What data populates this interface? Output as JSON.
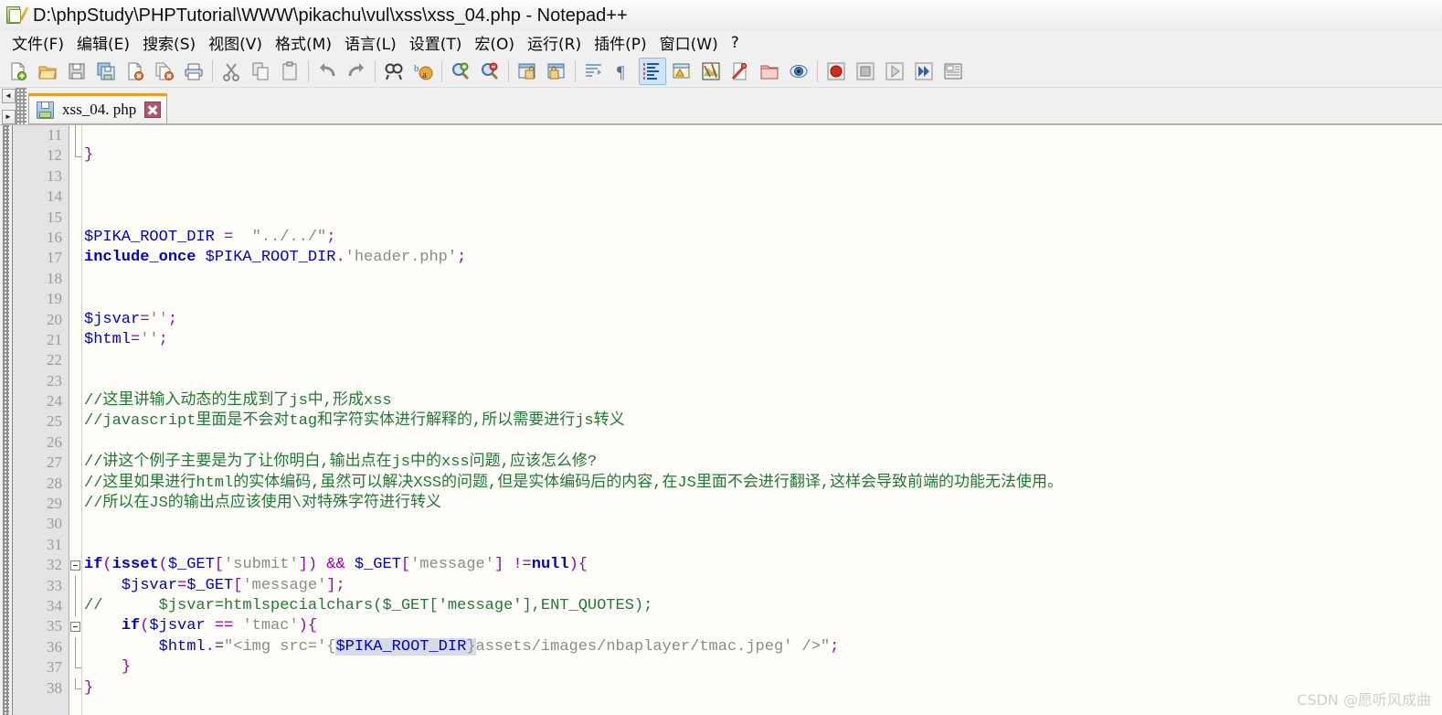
{
  "window": {
    "title": "D:\\phpStudy\\PHPTutorial\\WWW\\pikachu\\vul\\xss\\xss_04.php - Notepad++",
    "app_icon": "notepadpp-icon"
  },
  "menubar": {
    "items": [
      {
        "label": "文件(F)",
        "name": "menu-file"
      },
      {
        "label": "编辑(E)",
        "name": "menu-edit"
      },
      {
        "label": "搜索(S)",
        "name": "menu-search"
      },
      {
        "label": "视图(V)",
        "name": "menu-view"
      },
      {
        "label": "格式(M)",
        "name": "menu-format"
      },
      {
        "label": "语言(L)",
        "name": "menu-language"
      },
      {
        "label": "设置(T)",
        "name": "menu-settings"
      },
      {
        "label": "宏(O)",
        "name": "menu-macro"
      },
      {
        "label": "运行(R)",
        "name": "menu-run"
      },
      {
        "label": "插件(P)",
        "name": "menu-plugins"
      },
      {
        "label": "窗口(W)",
        "name": "menu-window"
      },
      {
        "label": "?",
        "name": "menu-help"
      }
    ]
  },
  "toolbar": {
    "groups": [
      [
        "new-file-icon",
        "open-folder-icon",
        "save-icon",
        "save-all-icon",
        "close-file-icon",
        "close-all-files-icon",
        "print-icon"
      ],
      [
        "cut-icon",
        "copy-icon",
        "paste-icon"
      ],
      [
        "undo-icon",
        "redo-icon"
      ],
      [
        "find-icon",
        "replace-icon"
      ],
      [
        "zoom-in-icon",
        "zoom-out-icon"
      ],
      [
        "sync-vertical-scroll-icon",
        "sync-horizontal-scroll-icon"
      ],
      [
        "word-wrap-icon",
        "show-all-characters-icon",
        "indent-guide-icon",
        "user-defined-language-icon",
        "document-map-icon",
        "function-list-icon",
        "folder-as-workspace-icon",
        "monitor-icon"
      ],
      [
        "record-macro-icon",
        "stop-recording-icon",
        "play-macro-icon",
        "run-macro-multiple-icon",
        "save-macro-icon"
      ]
    ],
    "pressed": "indent-guide-icon"
  },
  "tabbar": {
    "scroll_up_label": "◄",
    "scroll_down_label": "►",
    "tabs": [
      {
        "label": "xss_04. php",
        "icon": "saved-file-icon",
        "active": true,
        "close_label": "close-tab-icon"
      }
    ]
  },
  "editor": {
    "language": "PHP",
    "first_visible_line": 11,
    "line_numbers": [
      11,
      12,
      13,
      14,
      15,
      16,
      17,
      18,
      19,
      20,
      21,
      22,
      23,
      24,
      25,
      26,
      27,
      28,
      29,
      30,
      31,
      32,
      33,
      34,
      35,
      36,
      37,
      38
    ],
    "background_color": "#FFFEF8",
    "gutter_color": "#E4E4E4",
    "active_tab_accent": "#F0A020",
    "syntax_colors": {
      "variable": "#0000D0",
      "keyword": "#0000C8",
      "string": "#8A8A8A",
      "operator": "#9B00B4",
      "comment": "#1D7A34",
      "interpolation_highlight": "#D8DCE4"
    },
    "lines": [
      {
        "n": 11,
        "fold": "line",
        "tokens": []
      },
      {
        "n": 12,
        "fold": "end",
        "tokens": [
          {
            "t": "br",
            "s": "}"
          }
        ]
      },
      {
        "n": 13,
        "fold": "",
        "tokens": []
      },
      {
        "n": 14,
        "fold": "",
        "tokens": []
      },
      {
        "n": 15,
        "fold": "",
        "tokens": []
      },
      {
        "n": 16,
        "fold": "",
        "tokens": [
          {
            "t": "v",
            "s": "$PIKA_ROOT_DIR"
          },
          {
            "t": "p",
            "s": " "
          },
          {
            "t": "op",
            "s": "="
          },
          {
            "t": "p",
            "s": "  "
          },
          {
            "t": "st",
            "s": "\"../../\""
          },
          {
            "t": "op",
            "s": ";"
          }
        ]
      },
      {
        "n": 17,
        "fold": "",
        "tokens": [
          {
            "t": "kw",
            "s": "include_once"
          },
          {
            "t": "p",
            "s": " "
          },
          {
            "t": "v",
            "s": "$PIKA_ROOT_DIR"
          },
          {
            "t": "op",
            "s": "."
          },
          {
            "t": "st",
            "s": "'header.php'"
          },
          {
            "t": "op",
            "s": ";"
          }
        ]
      },
      {
        "n": 18,
        "fold": "",
        "tokens": []
      },
      {
        "n": 19,
        "fold": "",
        "tokens": []
      },
      {
        "n": 20,
        "fold": "",
        "tokens": [
          {
            "t": "v",
            "s": "$jsvar"
          },
          {
            "t": "op",
            "s": "="
          },
          {
            "t": "st",
            "s": "''"
          },
          {
            "t": "op",
            "s": ";"
          }
        ]
      },
      {
        "n": 21,
        "fold": "",
        "tokens": [
          {
            "t": "v",
            "s": "$html"
          },
          {
            "t": "op",
            "s": "="
          },
          {
            "t": "st",
            "s": "''"
          },
          {
            "t": "op",
            "s": ";"
          }
        ]
      },
      {
        "n": 22,
        "fold": "",
        "tokens": []
      },
      {
        "n": 23,
        "fold": "",
        "tokens": []
      },
      {
        "n": 24,
        "fold": "",
        "tokens": [
          {
            "t": "cm",
            "s": "//这里讲输入动态的生成到了js中,形成xss"
          }
        ]
      },
      {
        "n": 25,
        "fold": "",
        "tokens": [
          {
            "t": "cm",
            "s": "//javascript里面是不会对tag和字符实体进行解释的,所以需要进行js转义"
          }
        ]
      },
      {
        "n": 26,
        "fold": "",
        "tokens": []
      },
      {
        "n": 27,
        "fold": "",
        "tokens": [
          {
            "t": "cm",
            "s": "//讲这个例子主要是为了让你明白,输出点在js中的xss问题,应该怎么修?"
          }
        ]
      },
      {
        "n": 28,
        "fold": "",
        "tokens": [
          {
            "t": "cm",
            "s": "//这里如果进行html的实体编码,虽然可以解决XSS的问题,但是实体编码后的内容,在JS里面不会进行翻译,这样会导致前端的功能无法使用。"
          }
        ]
      },
      {
        "n": 29,
        "fold": "",
        "tokens": [
          {
            "t": "cm",
            "s": "//所以在JS的输出点应该使用\\对特殊字符进行转义"
          }
        ]
      },
      {
        "n": 30,
        "fold": "",
        "tokens": []
      },
      {
        "n": 31,
        "fold": "",
        "tokens": []
      },
      {
        "n": 32,
        "fold": "start",
        "tokens": [
          {
            "t": "kw",
            "s": "if"
          },
          {
            "t": "op",
            "s": "("
          },
          {
            "t": "fn",
            "s": "isset"
          },
          {
            "t": "op",
            "s": "("
          },
          {
            "t": "v",
            "s": "$_GET"
          },
          {
            "t": "op",
            "s": "["
          },
          {
            "t": "st",
            "s": "'submit'"
          },
          {
            "t": "op",
            "s": "])"
          },
          {
            "t": "p",
            "s": " "
          },
          {
            "t": "op",
            "s": "&&"
          },
          {
            "t": "p",
            "s": " "
          },
          {
            "t": "v",
            "s": "$_GET"
          },
          {
            "t": "op",
            "s": "["
          },
          {
            "t": "st",
            "s": "'message'"
          },
          {
            "t": "op",
            "s": "]"
          },
          {
            "t": "p",
            "s": " "
          },
          {
            "t": "op",
            "s": "!="
          },
          {
            "t": "kw",
            "s": "null"
          },
          {
            "t": "op",
            "s": "){"
          }
        ]
      },
      {
        "n": 33,
        "fold": "line",
        "tokens": [
          {
            "t": "p",
            "s": "    "
          },
          {
            "t": "v",
            "s": "$jsvar"
          },
          {
            "t": "op",
            "s": "="
          },
          {
            "t": "v",
            "s": "$_GET"
          },
          {
            "t": "op",
            "s": "["
          },
          {
            "t": "st",
            "s": "'message'"
          },
          {
            "t": "op",
            "s": "];"
          }
        ]
      },
      {
        "n": 34,
        "fold": "line",
        "tokens": [
          {
            "t": "cm",
            "s": "//      $jsvar=htmlspecialchars($_GET['message'],ENT_QUOTES);"
          }
        ]
      },
      {
        "n": 35,
        "fold": "start2",
        "tokens": [
          {
            "t": "p",
            "s": "    "
          },
          {
            "t": "kw",
            "s": "if"
          },
          {
            "t": "op",
            "s": "("
          },
          {
            "t": "v",
            "s": "$jsvar"
          },
          {
            "t": "p",
            "s": " "
          },
          {
            "t": "op",
            "s": "=="
          },
          {
            "t": "p",
            "s": " "
          },
          {
            "t": "st",
            "s": "'tmac'"
          },
          {
            "t": "op",
            "s": "){"
          }
        ]
      },
      {
        "n": 36,
        "fold": "line2",
        "tokens": [
          {
            "t": "p",
            "s": "        "
          },
          {
            "t": "v",
            "s": "$html"
          },
          {
            "t": "op",
            "s": ".="
          },
          {
            "t": "st",
            "s": "\"<img src='{"
          },
          {
            "t": "vhl",
            "s": "$PIKA_ROOT_DIR"
          },
          {
            "t": "sthl",
            "s": "}"
          },
          {
            "t": "st",
            "s": "assets/images/nbaplayer/tmac.jpeg' />\""
          },
          {
            "t": "op",
            "s": ";"
          }
        ]
      },
      {
        "n": 37,
        "fold": "end2",
        "tokens": [
          {
            "t": "p",
            "s": "    "
          },
          {
            "t": "br",
            "s": "}"
          }
        ]
      },
      {
        "n": 38,
        "fold": "end",
        "tokens": [
          {
            "t": "br",
            "s": "}"
          }
        ]
      }
    ]
  },
  "watermark": {
    "text": "CSDN @愿听风成曲"
  }
}
